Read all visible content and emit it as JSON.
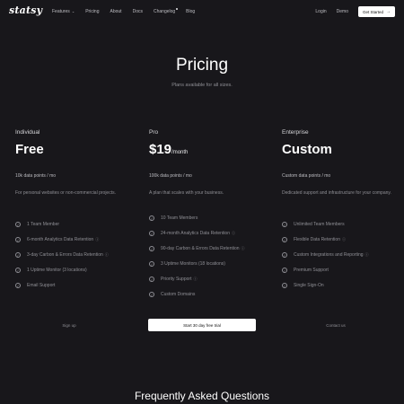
{
  "nav": {
    "logo": "statsy",
    "links": [
      "Features",
      "Pricing",
      "About",
      "Docs",
      "Changelog",
      "Blog"
    ],
    "login": "Login",
    "demo": "Demo",
    "cta": "Get Started"
  },
  "hero": {
    "title": "Pricing",
    "subtitle": "Plans available for all sizes."
  },
  "plans": [
    {
      "name": "Individual",
      "price": "Free",
      "price_suffix": "",
      "quota": "10k data points / mo",
      "description": "For personal websites or non-commercial projects.",
      "features": [
        "1 Team Member",
        "6-month Analytics Data Retention",
        "3-day Carbon & Errors Data Retention",
        "1 Uptime Monitor (3 locations)",
        "Email Support"
      ],
      "cta": "Sign up"
    },
    {
      "name": "Pro",
      "price": "$19",
      "price_suffix": "/month",
      "quota": "100k data points / mo",
      "description": "A plan that scales with your business.",
      "features": [
        "10 Team Members",
        "24-month Analytics Data Retention",
        "90-day Carbon & Errors Data Retention",
        "3 Uptime Monitors (18 locations)",
        "Priority Support",
        "Custom Domains"
      ],
      "cta": "Start 30 day free trial"
    },
    {
      "name": "Enterprise",
      "price": "Custom",
      "price_suffix": "",
      "quota": "Custom data points / mo",
      "description": "Dedicated support and infrastructure for your company.",
      "features": [
        "Unlimited Team Members",
        "Flexible Data Retention",
        "Custom Integrations and Reporting",
        "Premium Support",
        "Single Sign-On"
      ],
      "cta": "Contact us"
    }
  ],
  "faq": {
    "title": "Frequently Asked Questions"
  }
}
